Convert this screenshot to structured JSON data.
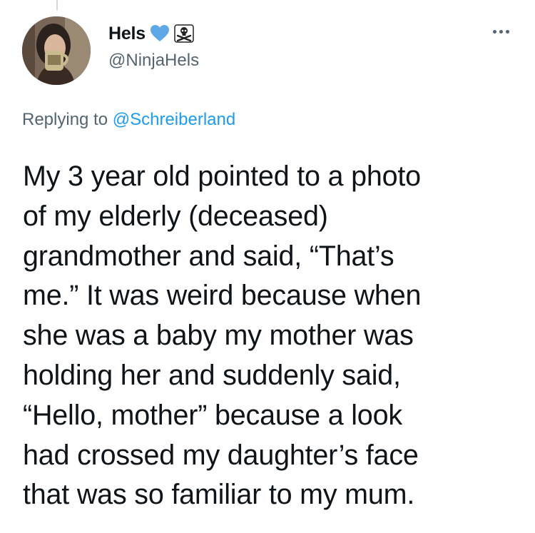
{
  "author": {
    "display_name": "Hels",
    "handle": "@NinjaHels",
    "badges": [
      "blue-heart-icon",
      "pirate-flag-icon"
    ],
    "avatar": "avatar-photo"
  },
  "reply": {
    "prefix": "Replying to",
    "mention": "@Schreiberland"
  },
  "more_menu_icon": "more-icon",
  "tweet_lines": [
    "My 3 year old pointed to a photo",
    "of my elderly (deceased)",
    "grandmother and said, “That’s",
    "me.” It was weird because when",
    "she was a baby my mother was",
    "holding her and suddenly said,",
    "“Hello, mother” because a look",
    "had crossed my daughter’s face",
    "that was so familiar to my mum."
  ],
  "colors": {
    "text": "#0f1419",
    "secondary": "#536471",
    "link": "#1d9bf0",
    "heart": "#5fa8e8"
  }
}
